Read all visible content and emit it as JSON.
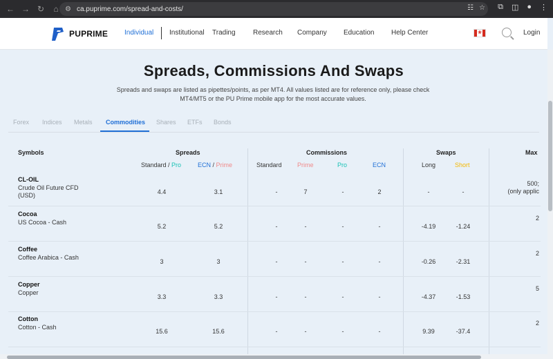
{
  "browser": {
    "url": "ca.puprime.com/spread-and-costs/"
  },
  "header": {
    "logo_text": "PUPRIME",
    "nav": [
      "Individual",
      "Institutional",
      "Trading",
      "Research",
      "Company",
      "Education",
      "Help Center"
    ],
    "active_nav": "Individual",
    "login_label": "Login"
  },
  "main": {
    "title": "Spreads, Commissions And Swaps",
    "description": "Spreads and swaps are listed as pipettes/points, as per MT4. All values listed are for reference only, please check MT4/MT5 or the PU Prime mobile app for the most accurate values.",
    "tabs": [
      "Forex",
      "Indices",
      "Metals",
      "Commodities",
      "Shares",
      "ETFs",
      "Bonds"
    ],
    "active_tab": "Commodities"
  },
  "table": {
    "symbols_header": "Symbols",
    "spreads_header": "Spreads",
    "commissions_header": "Commissions",
    "swaps_header": "Swaps",
    "max_header": "Max",
    "spreads_sub": [
      {
        "a": "Standard",
        "sep": " / ",
        "b": "Pro"
      },
      {
        "a": "ECN",
        "sep": " / ",
        "b": "Prime"
      }
    ],
    "commission_sub": [
      "Standard",
      "Prime",
      "Pro",
      "ECN"
    ],
    "swap_sub": [
      "Long",
      "Short"
    ],
    "colors": {
      "pro": "#19c2b5",
      "prime": "#f08a8a",
      "ecn": "#1f6fd6",
      "short": "#f5b800",
      "standard": "#333333",
      "long": "#333333"
    },
    "rows": [
      {
        "code": "CL-OIL",
        "name": "Crude Oil Future CFD (USD)",
        "spread_std": "4.4",
        "spread_ecn": "3.1",
        "com_std": "-",
        "com_prime": "7",
        "com_pro": "-",
        "com_ecn": "2",
        "swap_long": "-",
        "swap_short": "-",
        "max": "500;",
        "max2": "(only applic"
      },
      {
        "code": "Cocoa",
        "name": "US Cocoa - Cash",
        "spread_std": "5.2",
        "spread_ecn": "5.2",
        "com_std": "-",
        "com_prime": "-",
        "com_pro": "-",
        "com_ecn": "-",
        "swap_long": "-4.19",
        "swap_short": "-1.24",
        "max": "2",
        "max2": ""
      },
      {
        "code": "Coffee",
        "name": "Coffee Arabica - Cash",
        "spread_std": "3",
        "spread_ecn": "3",
        "com_std": "-",
        "com_prime": "-",
        "com_pro": "-",
        "com_ecn": "-",
        "swap_long": "-0.26",
        "swap_short": "-2.31",
        "max": "2",
        "max2": ""
      },
      {
        "code": "Copper",
        "name": "Copper",
        "spread_std": "3.3",
        "spread_ecn": "3.3",
        "com_std": "-",
        "com_prime": "-",
        "com_pro": "-",
        "com_ecn": "-",
        "swap_long": "-4.37",
        "swap_short": "-1.53",
        "max": "5",
        "max2": ""
      },
      {
        "code": "Cotton",
        "name": "Cotton - Cash",
        "spread_std": "15.6",
        "spread_ecn": "15.6",
        "com_std": "-",
        "com_prime": "-",
        "com_pro": "-",
        "com_ecn": "-",
        "swap_long": "9.39",
        "swap_short": "-37.4",
        "max": "2",
        "max2": ""
      }
    ]
  }
}
